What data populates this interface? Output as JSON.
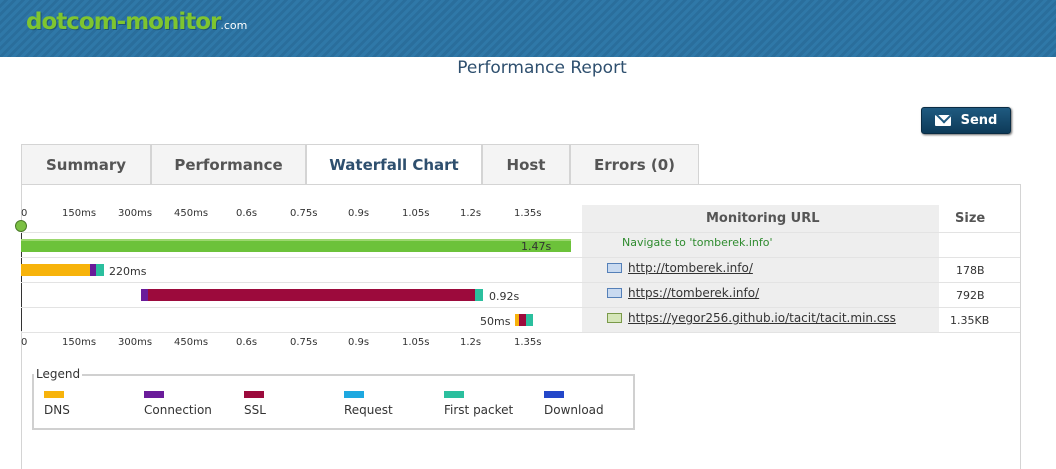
{
  "app": {
    "logo_main": "dotcom-monitor",
    "logo_suffix": ".com"
  },
  "page_title": "Performance Report",
  "send_label": "Send",
  "tabs": [
    {
      "label": "Summary"
    },
    {
      "label": "Performance"
    },
    {
      "label": "Waterfall Chart"
    },
    {
      "label": "Host"
    },
    {
      "label": "Errors (0)"
    }
  ],
  "waterfall": {
    "ticks": [
      "0",
      "150ms",
      "300ms",
      "450ms",
      "0.6s",
      "0.75s",
      "0.9s",
      "1.05s",
      "1.2s",
      "1.35s"
    ],
    "columns": {
      "url": "Monitoring URL",
      "size": "Size"
    },
    "colors": {
      "total": "#6cc23a",
      "dns": "#f7b30b",
      "connection": "#6a1b9a",
      "ssl": "#9c0a3c",
      "request": "#1ea8e0",
      "first_packet": "#2bbf9e",
      "download": "#2447c9"
    },
    "rows": [
      {
        "label": "1.47s",
        "url": "Navigate to 'tomberek.info'",
        "size": "",
        "type": "navigate"
      },
      {
        "label": "220ms",
        "url": "http://tomberek.info/",
        "size": "178B",
        "type": "html"
      },
      {
        "label": "0.92s",
        "url": "https://tomberek.info/",
        "size": "792B",
        "type": "html"
      },
      {
        "label": "50ms",
        "url": "https://yegor256.github.io/tacit/tacit.min.css",
        "size": "1.35KB",
        "type": "css"
      }
    ]
  },
  "legend": {
    "title": "Legend",
    "items": [
      "DNS",
      "Connection",
      "SSL",
      "Request",
      "First packet",
      "Download"
    ]
  }
}
